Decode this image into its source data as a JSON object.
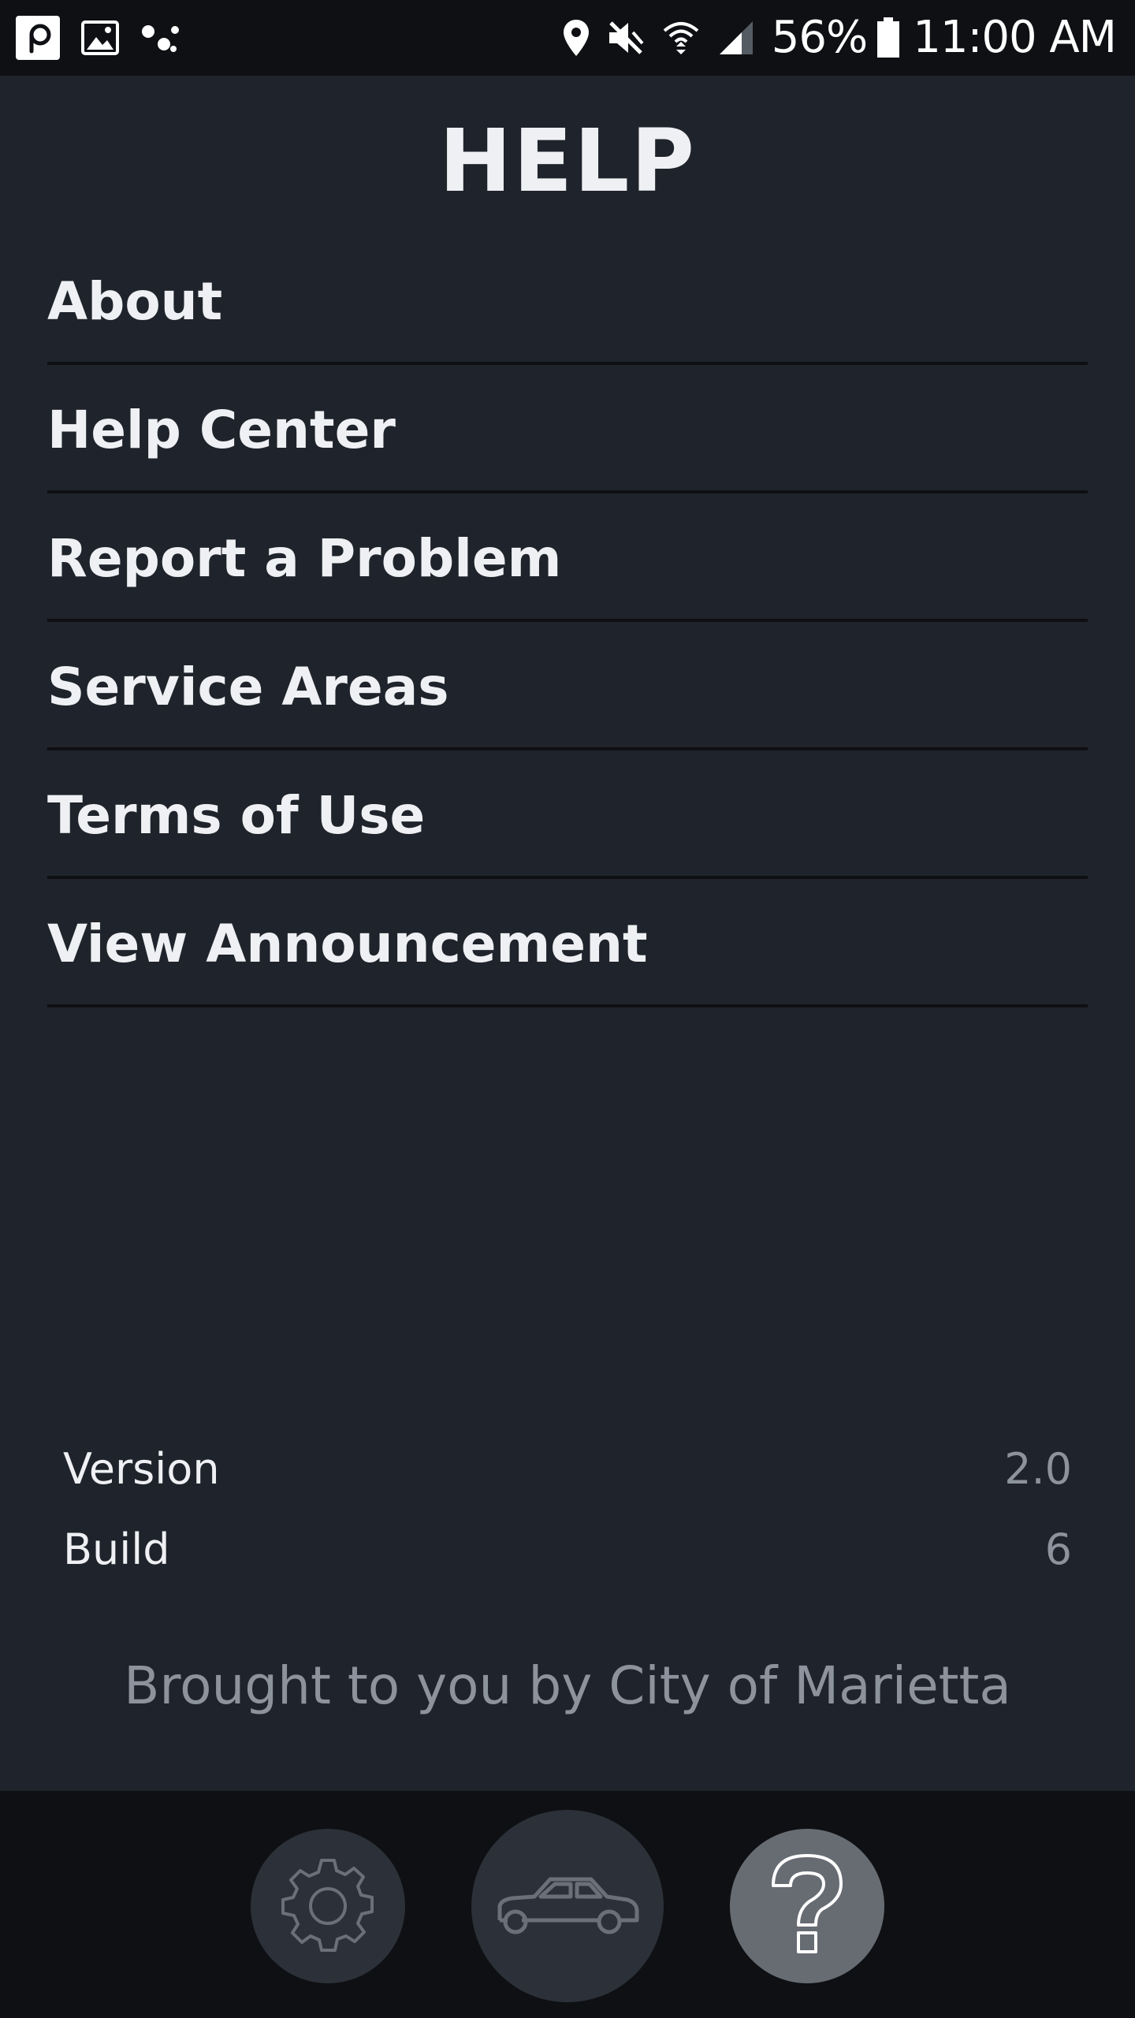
{
  "status_bar": {
    "battery_percent": "56%",
    "time": "11:00 AM",
    "icons": [
      "p-app-icon",
      "image-icon",
      "assistant-icon",
      "location-icon",
      "mute-icon",
      "wifi-icon",
      "signal-icon",
      "battery-icon"
    ]
  },
  "header": {
    "title": "HELP"
  },
  "menu": {
    "items": [
      {
        "label": "About"
      },
      {
        "label": "Help Center"
      },
      {
        "label": "Report a Problem"
      },
      {
        "label": "Service Areas"
      },
      {
        "label": "Terms of Use"
      },
      {
        "label": "View Announcement"
      }
    ]
  },
  "app_info": {
    "version_label": "Version",
    "version_value": "2.0",
    "build_label": "Build",
    "build_value": "6"
  },
  "footer": {
    "note": "Brought to you by City of Marietta"
  },
  "tab_bar": {
    "tabs": [
      {
        "name": "settings",
        "icon": "gear-icon"
      },
      {
        "name": "vehicle",
        "icon": "car-icon"
      },
      {
        "name": "help",
        "icon": "question-mark-icon",
        "active": true
      }
    ]
  },
  "colors": {
    "background": "#1f232b",
    "status_bar": "#0e1013",
    "text_primary": "#eef0f3",
    "text_secondary": "#8c939c",
    "tab_inactive": "#2c3038",
    "tab_active": "#676c73"
  }
}
